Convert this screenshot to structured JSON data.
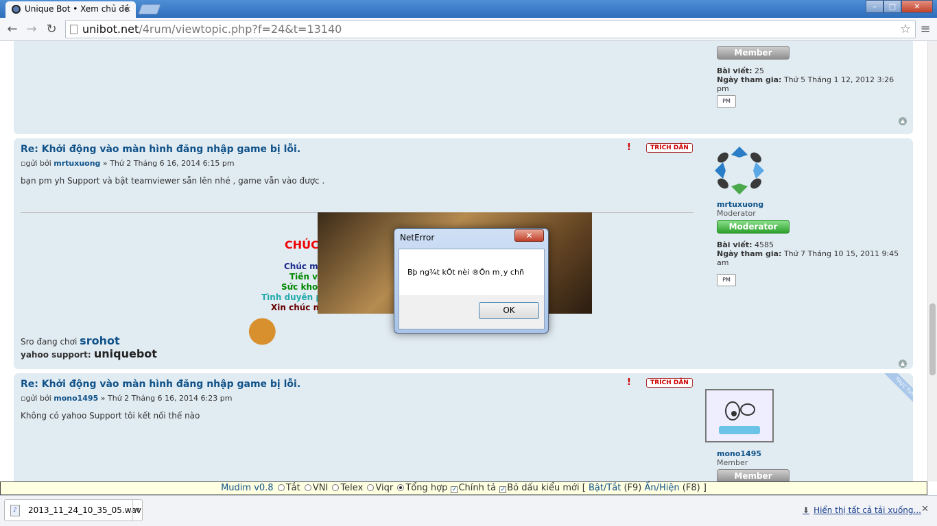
{
  "browser": {
    "tab_title": "Unique Bot • Xem chủ đề",
    "url_host": "unibot.net",
    "url_path": "/4rum/viewtopic.php?f=24&t=13140"
  },
  "top_profile": {
    "rank_badge": "Member",
    "posts_label": "Bài viết:",
    "posts": "25",
    "joined_label": "Ngày tham gia:",
    "joined": "Thứ 5 Tháng 1 12, 2012 3:26 pm",
    "pm": "PM"
  },
  "posts": [
    {
      "title": "Re: Khởi động vào màn hình đăng nhập game bị lỗi.",
      "by_label": "gửi bởi",
      "author": "mrtuxuong",
      "date": "» Thứ 2 Tháng 6 16, 2014 6:15 pm",
      "body": "bạn pm yh Support và bật teamviewer sẵn lên nhé , game vẫn vào được .",
      "quote": "TRÍCH DẪN",
      "profile": {
        "name": "mrtuxuong",
        "rank": "Moderator",
        "rank_badge": "Moderator",
        "posts_label": "Bài viết:",
        "posts": "4585",
        "joined_label": "Ngày tham gia:",
        "joined": "Thứ 7 Tháng 10 15, 2011 9:45 am",
        "pm": "PM"
      },
      "signature": {
        "greeting_title": "CHÚC M",
        "greeting_lines": [
          "Chúc mọi n",
          "Tiền vô x",
          "Sức khoẻ c",
          "Tình duyên phơ",
          "Xin chúc mọi n"
        ],
        "line1_label": "Sro đang chơi",
        "line1_value": "srohot",
        "line2_label": "yahoo support:",
        "line2_value": "uniquebot"
      }
    },
    {
      "title": "Re: Khởi động vào màn hình đăng nhập game bị lỗi.",
      "by_label": "gửi bởi",
      "author": "mono1495",
      "date": "» Thứ 2 Tháng 6 16, 2014 6:23 pm",
      "body": "Không có yahoo Support tôi kết nối thế nào",
      "quote": "TRÍCH DẪN",
      "corner": "TRỰC TUYẾN",
      "profile": {
        "name": "mono1495",
        "rank": "Member",
        "rank_badge": "Member"
      }
    }
  ],
  "mudim": {
    "name": "Mudim v0.8",
    "opts": [
      "Tắt",
      "VNI",
      "Telex",
      "Viqr",
      "Tổng hợp"
    ],
    "spell": "Chính tả",
    "newstyle": "Bỏ dấu kiểu mới",
    "toggle": "Bật/Tắt",
    "toggle_key": "(F9)",
    "showhide": "Ẩn/Hiện",
    "showhide_key": "(F8)",
    "bracket_open": "[",
    "bracket_close": "]"
  },
  "download": {
    "filename": "2013_11_24_10_35_05.wav",
    "show_all": "Hiển thị tất cả tải xuống..."
  },
  "dialog": {
    "title": "NetError",
    "message": "Bþ ng¾t kÕt nèi ®Õn m¸y chñ",
    "ok": "OK"
  }
}
